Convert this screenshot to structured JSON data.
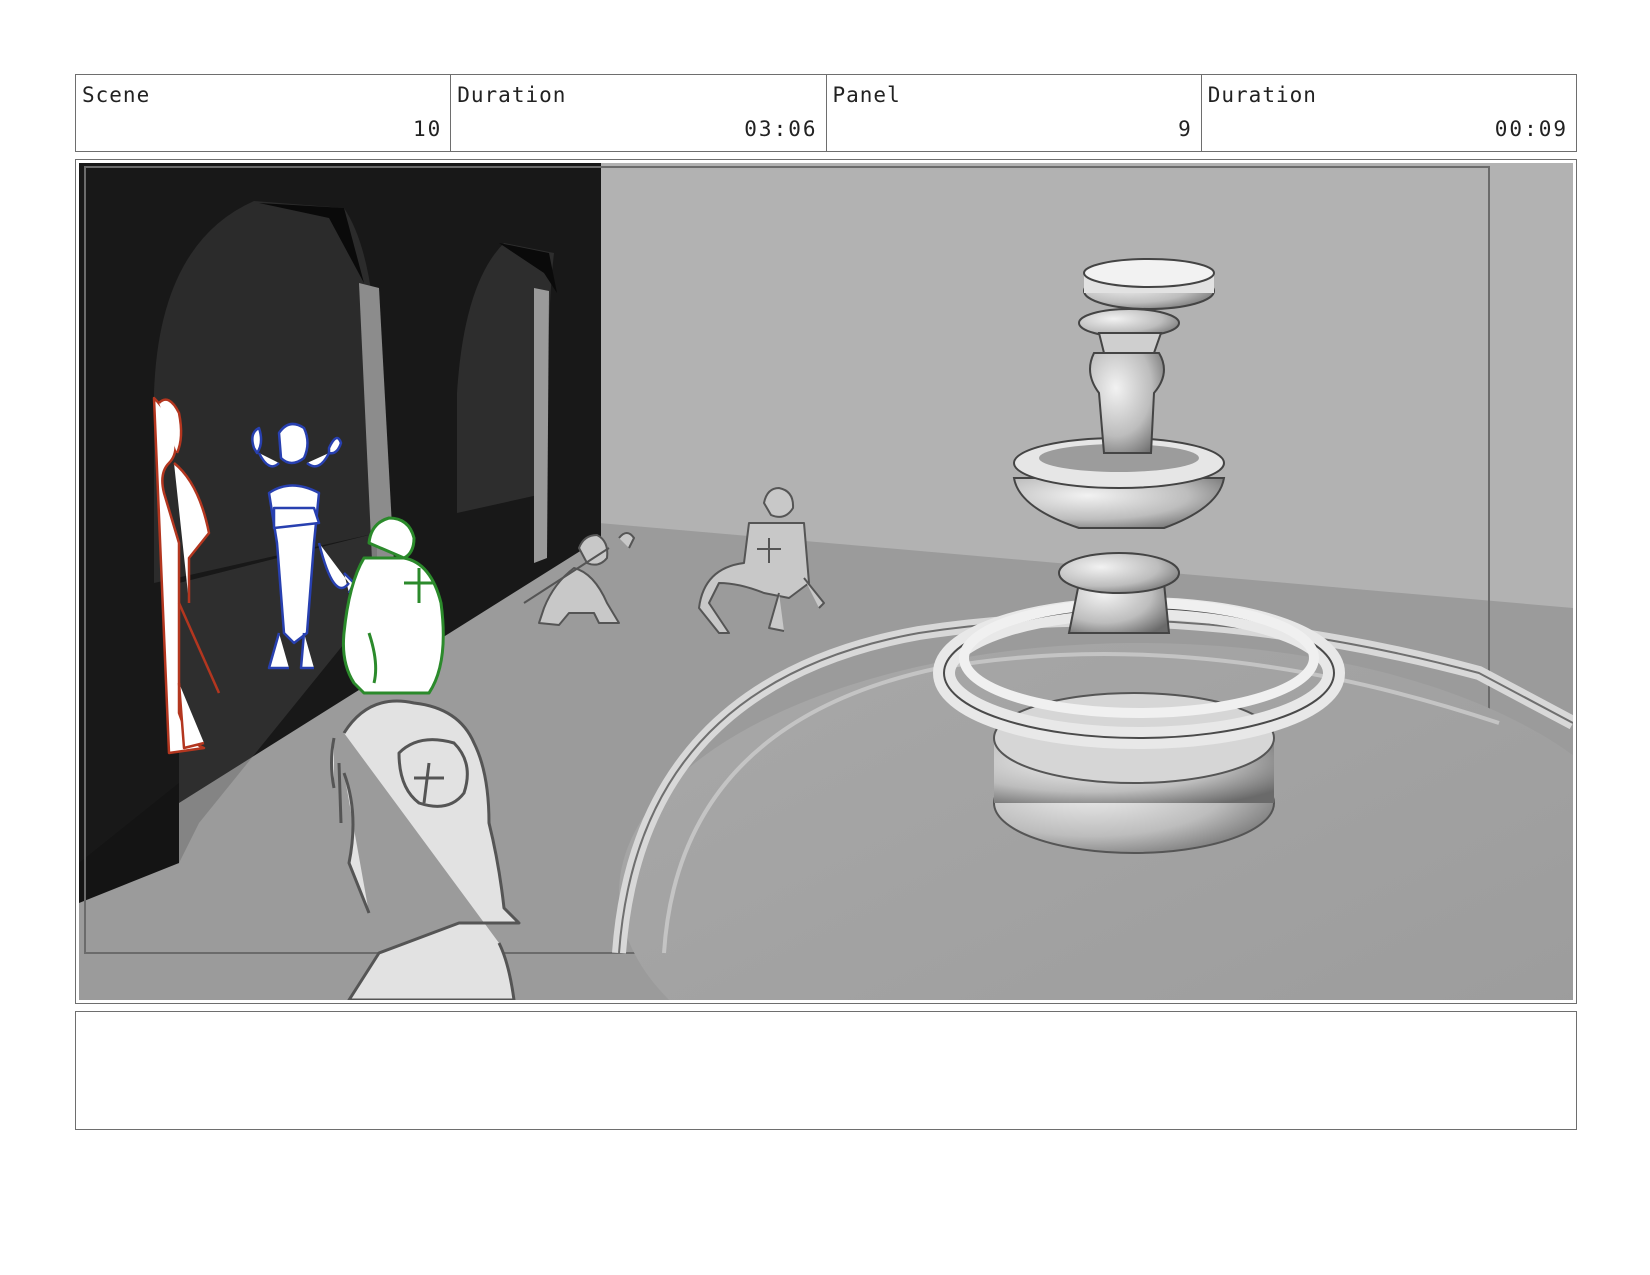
{
  "header": {
    "scene_label": "Scene",
    "scene_value": "10",
    "scene_duration_label": "Duration",
    "scene_duration_value": "03:06",
    "panel_label": "Panel",
    "panel_value": "9",
    "panel_duration_label": "Duration",
    "panel_duration_value": "00:09"
  },
  "notes": {
    "text": ""
  },
  "colors": {
    "background": "#ffffff",
    "border": "#6e6e6e",
    "wall_dark": "#171717",
    "floor": "#999999",
    "back_wall": "#b0b0b0",
    "sketch_red": "#b3361f",
    "sketch_blue": "#2840b0",
    "sketch_green": "#2b8a2b"
  }
}
